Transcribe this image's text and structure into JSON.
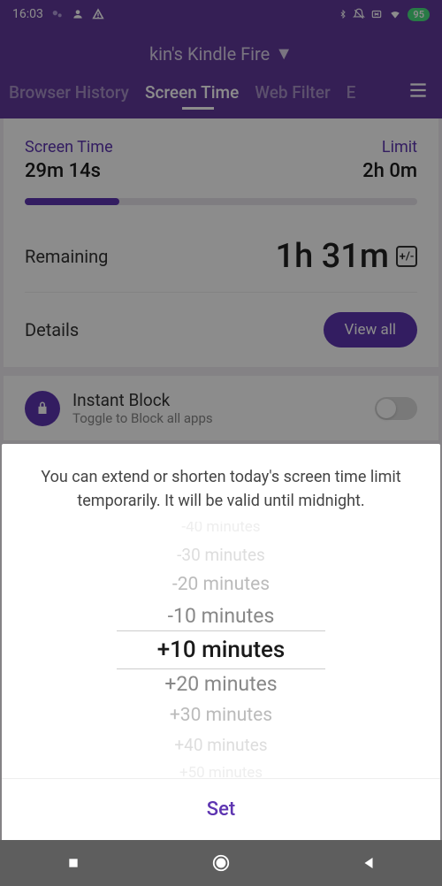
{
  "status": {
    "time": "16:03",
    "battery": "95"
  },
  "header": {
    "device": "kin's Kindle Fire",
    "tabs": [
      "Browser History",
      "Screen Time",
      "Web Filter",
      "E"
    ]
  },
  "screenTime": {
    "usedLabel": "Screen Time",
    "usedValue": "29m 14s",
    "limitLabel": "Limit",
    "limitValue": "2h 0m",
    "progressPercent": 24,
    "remainingLabel": "Remaining",
    "remainingValue": "1h 31m",
    "detailsLabel": "Details",
    "viewAll": "View all"
  },
  "instantBlock": {
    "title": "Instant Block",
    "subtitle": "Toggle to Block all apps"
  },
  "sheet": {
    "text": "You can extend or shorten today's screen time limit temporarily. It will be valid until midnight.",
    "options": [
      "-40 minutes",
      "-30 minutes",
      "-20 minutes",
      "-10 minutes",
      "+10 minutes",
      "+20 minutes",
      "+30 minutes",
      "+40 minutes",
      "+50 minutes"
    ],
    "setLabel": "Set"
  }
}
